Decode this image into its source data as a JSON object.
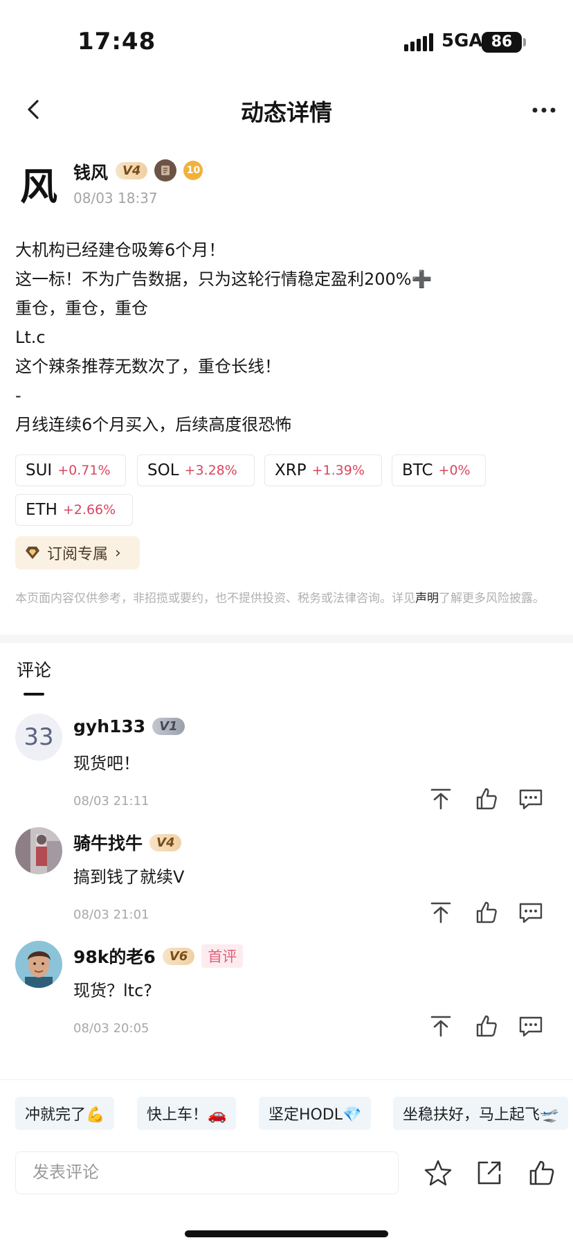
{
  "status_bar": {
    "time": "17:48",
    "network": "5GA",
    "battery": "86"
  },
  "nav": {
    "title": "动态详情",
    "back_icon": "chevron-left-icon",
    "more_icon": "more-dots-icon"
  },
  "author": {
    "avatar_text": "风",
    "name": "钱风",
    "level": "V4",
    "badge_number": "10",
    "time": "08/03 18:37"
  },
  "post": {
    "lines": [
      "大机构已经建仓吸筹6个月！",
      "这一标！不为广告数据，只为这轮行情稳定盈利200%➕",
      "重仓，重仓，重仓",
      "Lt.c",
      "这个辣条推荐无数次了，重仓长线！",
      "-",
      "月线连续6个月买入，后续高度很恐怖"
    ]
  },
  "tickers": [
    {
      "symbol": "SUI",
      "change": "+0.71%"
    },
    {
      "symbol": "SOL",
      "change": "+3.28%"
    },
    {
      "symbol": "XRP",
      "change": "+1.39%"
    },
    {
      "symbol": "BTC",
      "change": "+0%"
    },
    {
      "symbol": "ETH",
      "change": "+2.66%"
    }
  ],
  "subscribe": {
    "label": "订阅专属",
    "icon": "diamond-icon"
  },
  "disclaimer": {
    "before": "本页面内容仅供参考，非招揽或要约，也不提供投资、税务或法律咨询。详见",
    "link": "声明",
    "after": "了解更多风险披露。"
  },
  "comments_section": {
    "title": "评论",
    "items": [
      {
        "avatar_text": "33",
        "name": "gyh133",
        "level": "V1",
        "text": "现货吧！",
        "time": "08/03 21:11"
      },
      {
        "avatar_text": "",
        "name": "骑牛找牛",
        "level": "V4",
        "text": "搞到钱了就续V",
        "time": "08/03 21:01"
      },
      {
        "avatar_text": "",
        "name": "98k的老6",
        "level": "V6",
        "tag": "首评",
        "text": "现货？ltc?",
        "time": "08/03 20:05"
      }
    ]
  },
  "quick_replies": [
    "冲就完了💪",
    "快上车！🚗",
    "坚定HODL💎",
    "坐稳扶好，马上起飞🛫"
  ],
  "bottom": {
    "input_placeholder": "发表评论"
  },
  "colors": {
    "positive": "#d8455f",
    "accent_gold": "#efd0a4",
    "chip_bg": "#f0f5fa"
  }
}
